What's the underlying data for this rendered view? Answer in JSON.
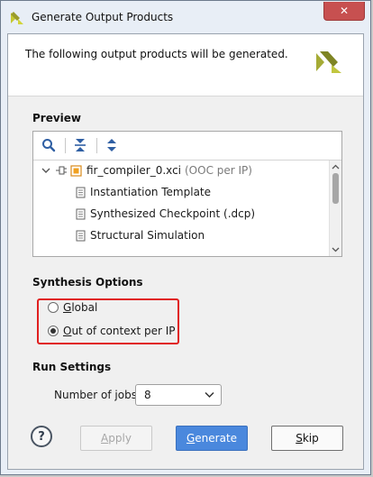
{
  "window": {
    "title": "Generate Output Products",
    "close_glyph": "✕"
  },
  "header": {
    "message": "The following output products will be generated."
  },
  "preview": {
    "label": "Preview",
    "toolbar": [
      "search-icon",
      "collapse-all-icon",
      "expand-all-icon"
    ],
    "root": {
      "name": "fir_compiler_0.xci",
      "suffix": "(OOC per IP)"
    },
    "children": [
      "Instantiation Template",
      "Synthesized Checkpoint (.dcp)",
      "Structural Simulation"
    ]
  },
  "synthesis": {
    "label": "Synthesis Options",
    "options": [
      {
        "label": "Global",
        "selected": false
      },
      {
        "label": "Out of context per IP",
        "selected": true
      }
    ]
  },
  "run": {
    "label": "Run Settings",
    "jobs_label": "Number of jobs:",
    "jobs_value": "8"
  },
  "buttons": {
    "help": "?",
    "apply": "Apply",
    "generate": "Generate",
    "skip": "Skip"
  },
  "colors": {
    "accent": "#4a88dd",
    "highlight": "#e02020",
    "close": "#c75050",
    "logo": "#a5ab35"
  }
}
